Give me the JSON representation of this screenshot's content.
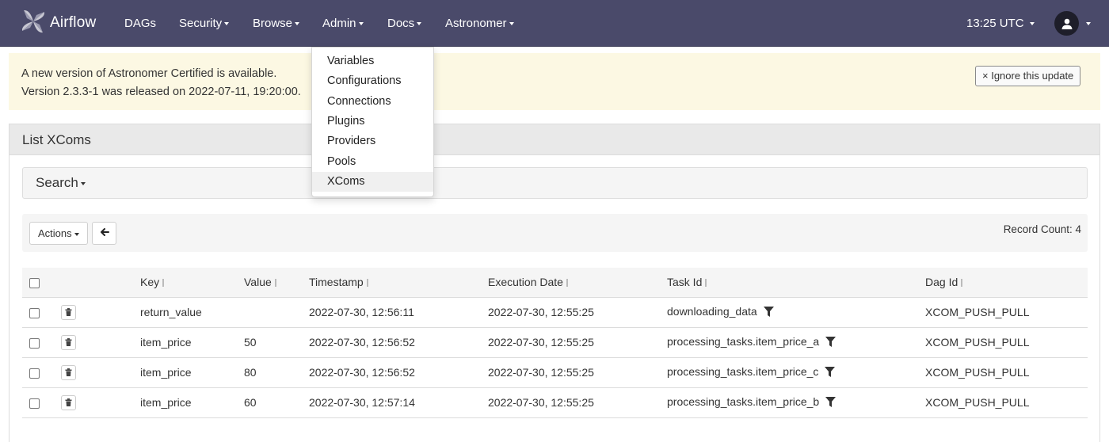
{
  "navbar": {
    "brand": "Airflow",
    "items": [
      {
        "label": "DAGs",
        "has_caret": false
      },
      {
        "label": "Security",
        "has_caret": true
      },
      {
        "label": "Browse",
        "has_caret": true
      },
      {
        "label": "Admin",
        "has_caret": true
      },
      {
        "label": "Docs",
        "has_caret": true
      },
      {
        "label": "Astronomer",
        "has_caret": true
      }
    ],
    "clock": "13:25 UTC",
    "user_icon": "user-icon",
    "background_color": "#4a4a6a"
  },
  "alert": {
    "line1": "A new version of Astronomer Certified is available.",
    "line2": "Version 2.3.3-1 was released on 2022-07-11, 19:20:00.",
    "ignore_button": "× Ignore this update",
    "background_color": "#fcf8e3"
  },
  "admin_menu": {
    "items": [
      "Variables",
      "Configurations",
      "Connections",
      "Plugins",
      "Providers",
      "Pools",
      "XComs"
    ],
    "active": "XComs"
  },
  "panel": {
    "title": "List XComs",
    "search_label": "Search",
    "actions_label": "Actions",
    "back_icon": "arrow-left-icon",
    "record_count": "Record Count: 4"
  },
  "table": {
    "columns": [
      "Key",
      "Value",
      "Timestamp",
      "Execution Date",
      "Task Id",
      "Dag Id"
    ],
    "rows": [
      {
        "key": "return_value",
        "value": "",
        "timestamp": "2022-07-30, 12:56:11",
        "execution_date": "2022-07-30, 12:55:25",
        "task_id": "downloading_data",
        "dag_id": "XCOM_PUSH_PULL"
      },
      {
        "key": "item_price",
        "value": "50",
        "timestamp": "2022-07-30, 12:56:52",
        "execution_date": "2022-07-30, 12:55:25",
        "task_id": "processing_tasks.item_price_a",
        "dag_id": "XCOM_PUSH_PULL"
      },
      {
        "key": "item_price",
        "value": "80",
        "timestamp": "2022-07-30, 12:56:52",
        "execution_date": "2022-07-30, 12:55:25",
        "task_id": "processing_tasks.item_price_c",
        "dag_id": "XCOM_PUSH_PULL"
      },
      {
        "key": "item_price",
        "value": "60",
        "timestamp": "2022-07-30, 12:57:14",
        "execution_date": "2022-07-30, 12:55:25",
        "task_id": "processing_tasks.item_price_b",
        "dag_id": "XCOM_PUSH_PULL"
      }
    ]
  }
}
